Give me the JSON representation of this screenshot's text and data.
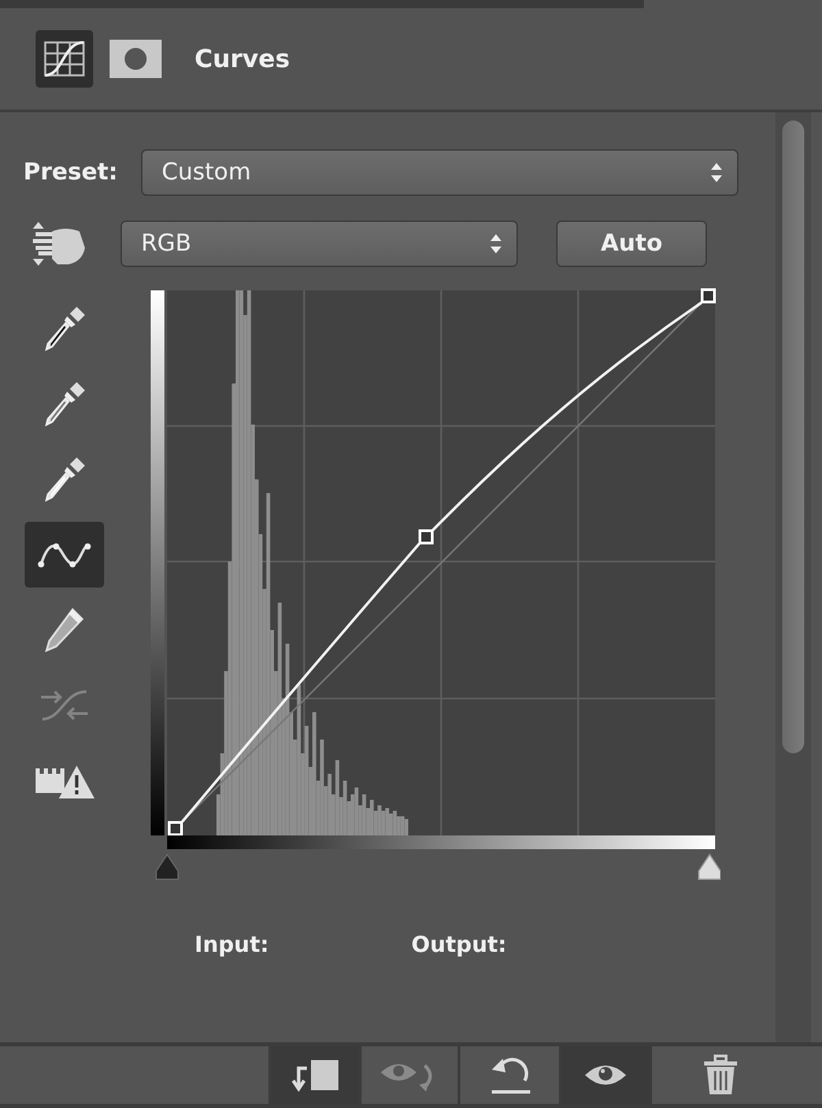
{
  "panel": {
    "title": "Curves"
  },
  "header_icons": [
    {
      "kind": "curves",
      "selected": true
    },
    {
      "kind": "mask",
      "selected": false
    }
  ],
  "preset": {
    "label": "Preset:",
    "value": "Custom"
  },
  "channel": {
    "value": "RGB"
  },
  "auto_button": "Auto",
  "tools": [
    {
      "kind": "eyedropper-black",
      "selected": false,
      "disabled": false
    },
    {
      "kind": "eyedropper-gray",
      "selected": false,
      "disabled": false
    },
    {
      "kind": "eyedropper-white",
      "selected": false,
      "disabled": false
    },
    {
      "kind": "point-curve",
      "selected": true,
      "disabled": false
    },
    {
      "kind": "pencil",
      "selected": false,
      "disabled": false
    },
    {
      "kind": "smooth",
      "selected": false,
      "disabled": true
    },
    {
      "kind": "clipping",
      "selected": false,
      "disabled": false
    }
  ],
  "readouts": [
    {
      "label": "Input:"
    },
    {
      "label": "Output:"
    }
  ],
  "footer_buttons": [
    {
      "kind": "clip",
      "selected": true,
      "disabled": false
    },
    {
      "kind": "view-previous",
      "selected": false,
      "disabled": true
    },
    {
      "kind": "reset",
      "selected": false,
      "disabled": false
    },
    {
      "kind": "visibility",
      "selected": true,
      "disabled": false
    },
    {
      "kind": "delete",
      "selected": false,
      "disabled": false
    }
  ]
}
